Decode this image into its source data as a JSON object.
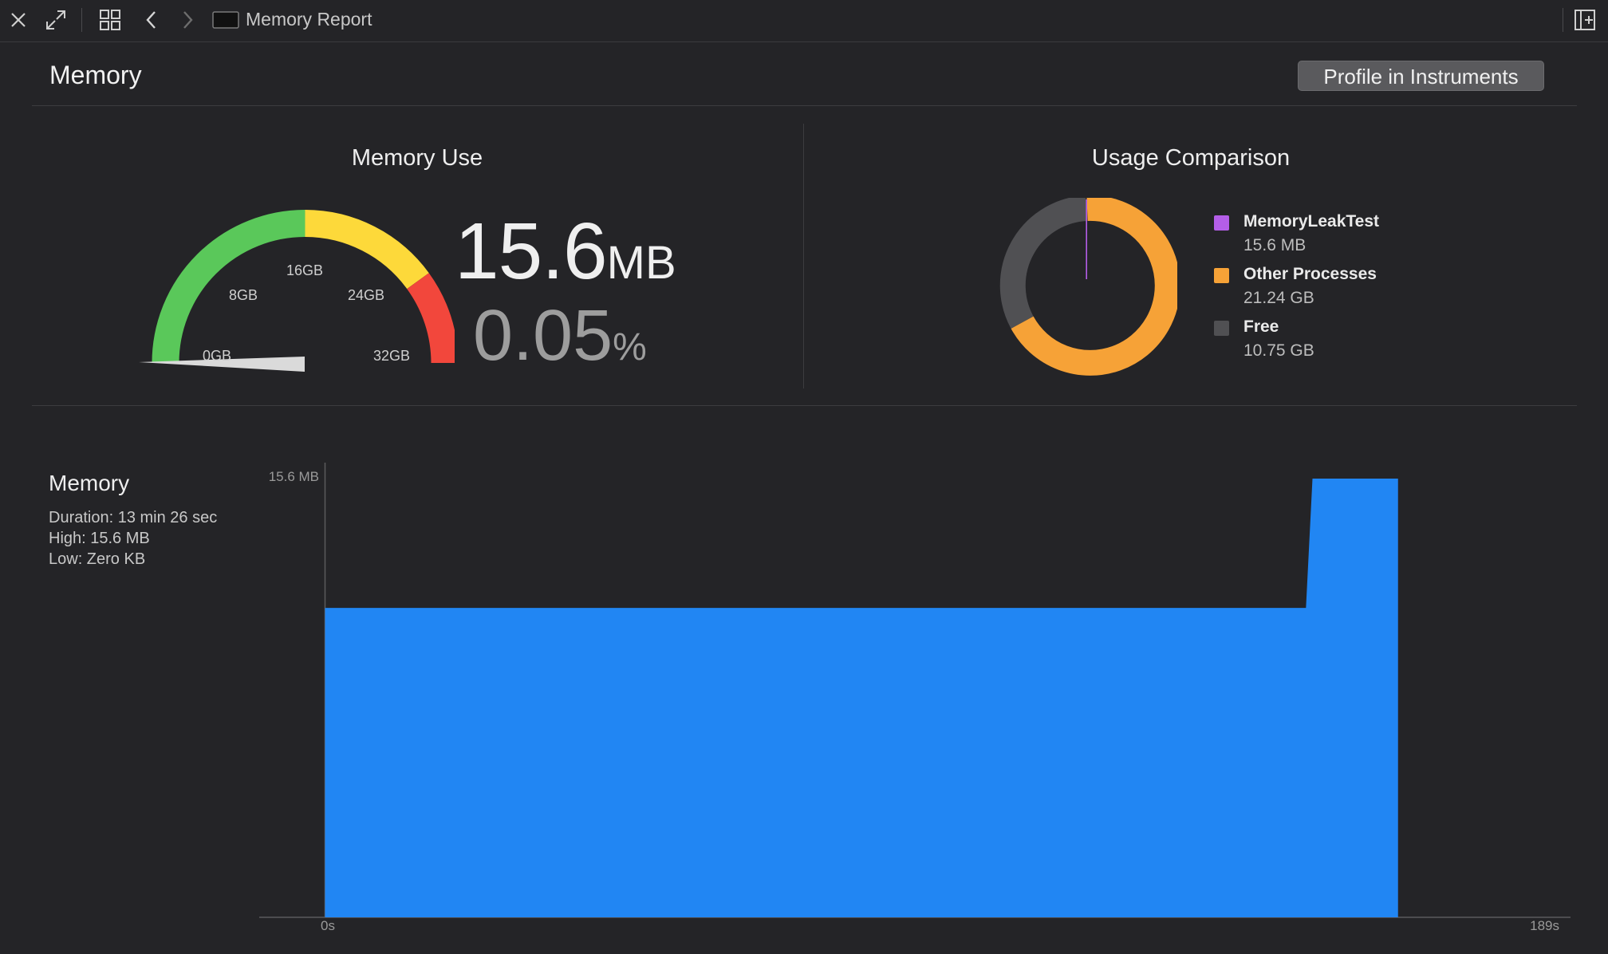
{
  "toolbar": {
    "tab_title": "Memory Report"
  },
  "header": {
    "title": "Memory",
    "profile_button": "Profile in Instruments"
  },
  "memory_use": {
    "title": "Memory Use",
    "value": "15.6",
    "value_unit": "MB",
    "percent": "0.05",
    "percent_unit": "%",
    "gauge_labels": [
      "0GB",
      "8GB",
      "16GB",
      "24GB",
      "32GB"
    ],
    "gauge_colors": {
      "green": "#5ac85a",
      "yellow": "#fdd93a",
      "red": "#f2473c"
    },
    "needle_fraction": 0.0005
  },
  "usage_comparison": {
    "title": "Usage Comparison",
    "items": [
      {
        "name": "MemoryLeakTest",
        "value": "15.6 MB",
        "color": "#b45ee8"
      },
      {
        "name": "Other Processes",
        "value": "21.24 GB",
        "color": "#f6a237"
      },
      {
        "name": "Free",
        "value": "10.75 GB",
        "color": "#505053"
      }
    ]
  },
  "chart": {
    "title": "Memory",
    "duration": "Duration: 13 min 26 sec",
    "high": "High: 15.6 MB",
    "low": "Low: Zero KB",
    "y_max_label": "15.6 MB",
    "x_start_label": "0s",
    "x_end_label": "189s",
    "fill_color": "#2186f3"
  },
  "chart_data": {
    "type": "area",
    "x": [
      0,
      150.2,
      151.2,
      164.3
    ],
    "y": [
      11.0,
      11.0,
      15.6,
      15.6
    ],
    "xlim": [
      0,
      189
    ],
    "ylim": [
      0,
      15.6
    ],
    "xlabel": "",
    "ylabel": "",
    "x_tick_labels": [
      "0s",
      "189s"
    ],
    "y_tick_labels": [
      "15.6 MB"
    ]
  }
}
